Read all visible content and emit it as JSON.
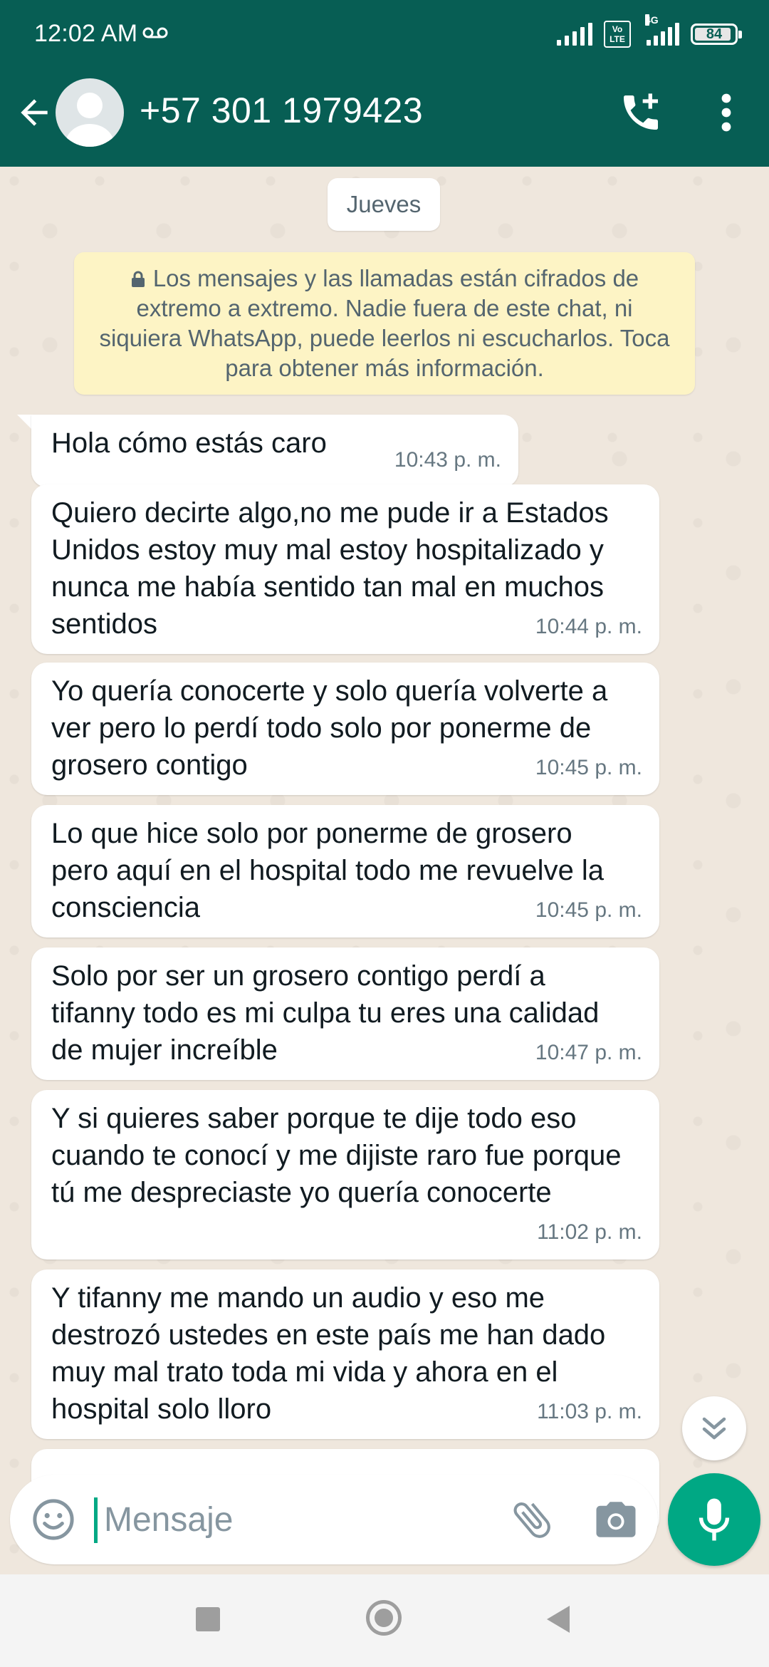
{
  "status_bar": {
    "time": "12:02 AM",
    "volte_line1": "Vo",
    "volte_line2": "LTE",
    "network_type": "4G",
    "battery": "84"
  },
  "header": {
    "contact": "+57 301 1979423",
    "icons": [
      "back-arrow-icon",
      "avatar",
      "add-call-icon",
      "more-vert-icon"
    ]
  },
  "chat": {
    "date_chip": "Jueves",
    "encryption_notice": "Los mensajes y las llamadas están cifrados de extremo a extremo. Nadie fuera de este chat, ni siquiera WhatsApp, puede leerlos ni escucharlos. Toca para obtener más información.",
    "messages": [
      {
        "text": "Hola cómo estás caro",
        "time": "10:43 p. m."
      },
      {
        "text": "Quiero decirte algo,no me pude ir a Estados Unidos estoy muy mal estoy hospitalizado y nunca me había sentido tan mal en muchos sentidos",
        "time": "10:44 p. m."
      },
      {
        "text": "Yo quería conocerte y solo quería volverte a ver pero lo perdí todo solo por ponerme de grosero contigo",
        "time": "10:45 p. m."
      },
      {
        "text": "Lo que hice solo por ponerme de grosero pero aquí en el hospital todo me revuelve la consciencia",
        "time": "10:45 p. m."
      },
      {
        "text": "Solo por ser un grosero contigo perdí a tifanny todo es mi culpa tu eres una calidad de mujer increíble",
        "time": "10:47 p. m."
      },
      {
        "text": "Y si quieres saber porque te dije todo eso cuando te conocí y me dijiste raro fue porque tú me despreciaste yo quería conocerte",
        "time": "11:02 p. m."
      },
      {
        "text": "Y tifanny me mando un audio y eso me destrozó ustedes en este país me han dado muy mal trato toda mi vida y ahora en el hospital solo lloro",
        "time": "11:03 p. m."
      }
    ]
  },
  "input": {
    "placeholder": "Mensaje"
  },
  "colors": {
    "header": "#075e54",
    "accent": "#00a884",
    "chat_bg": "#efe7dd",
    "notice_bg": "#fdf4c5"
  }
}
